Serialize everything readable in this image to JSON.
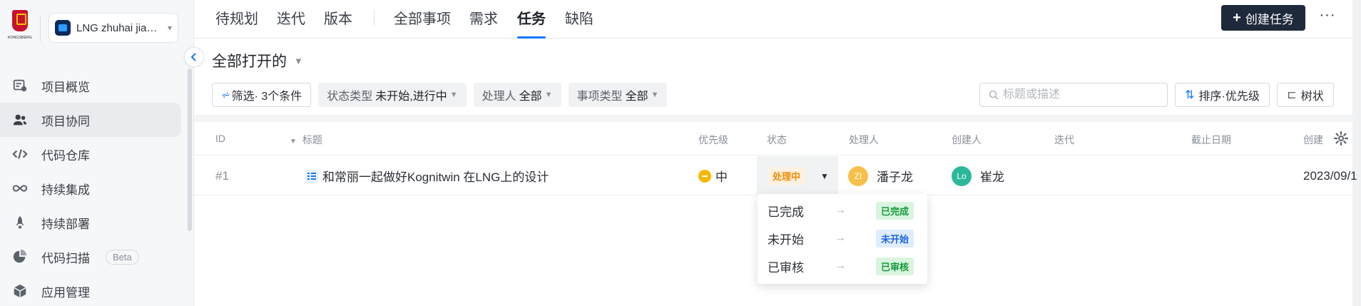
{
  "sidebar": {
    "logo_text": "KONGSBERG",
    "project_name": "LNG zhuhai jiang...",
    "items": [
      {
        "label": "项目概览",
        "icon": "overview-icon"
      },
      {
        "label": "项目协同",
        "icon": "team-icon",
        "active": true
      },
      {
        "label": "代码仓库",
        "icon": "code-icon"
      },
      {
        "label": "持续集成",
        "icon": "infinity-icon"
      },
      {
        "label": "持续部署",
        "icon": "rocket-icon"
      },
      {
        "label": "代码扫描",
        "icon": "pie-chart-icon",
        "badge": "Beta"
      },
      {
        "label": "应用管理",
        "icon": "cube-icon"
      }
    ]
  },
  "topnav": {
    "tabs": [
      "待规划",
      "迭代",
      "版本",
      "全部事项",
      "需求",
      "任务",
      "缺陷"
    ],
    "active_tab": "任务",
    "create_label": "创建任务",
    "more_label": "···"
  },
  "view": {
    "title": "全部打开的",
    "filter": {
      "label": "筛选· 3个条件"
    },
    "chips": [
      {
        "key": "状态类型",
        "value": "未开始,进行中"
      },
      {
        "key": "处理人",
        "value": "全部"
      },
      {
        "key": "事项类型",
        "value": "全部"
      }
    ],
    "search_placeholder": "标题或描述",
    "sort_label": "排序·优先级",
    "tree_label": "树状"
  },
  "table": {
    "columns": [
      "ID",
      "标题",
      "优先级",
      "状态",
      "处理人",
      "创建人",
      "迭代",
      "截止日期",
      "创建"
    ],
    "rows": [
      {
        "id": "#1",
        "title": "和常丽一起做好Kognitwin 在LNG上的设计",
        "priority": "中",
        "status": "处理中",
        "assignee": {
          "initials": "ZI",
          "name": "潘子龙",
          "color": "#f7c04a"
        },
        "creator": {
          "initials": "Lo",
          "name": "崔龙",
          "color": "#2bb89a"
        },
        "created": "2023/09/1"
      }
    ]
  },
  "status_menu": [
    {
      "label": "已完成",
      "tag": "已完成",
      "tone": "green"
    },
    {
      "label": "未开始",
      "tag": "未开始",
      "tone": "blue"
    },
    {
      "label": "已审核",
      "tag": "已审核",
      "tone": "green"
    }
  ],
  "colors": {
    "accent": "#1677ff",
    "primary_button": "#1e2a3b",
    "in_progress": "#f08a00"
  }
}
